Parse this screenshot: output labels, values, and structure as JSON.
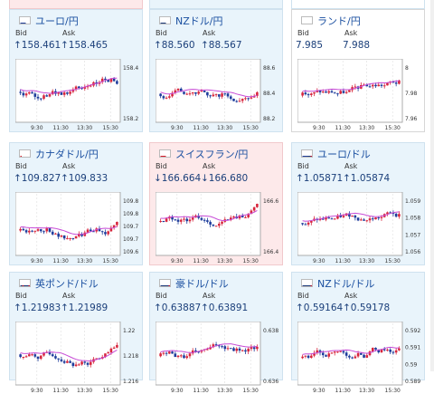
{
  "labels": {
    "bid": "Bid",
    "ask": "Ask"
  },
  "times": [
    "9:30",
    "11:30",
    "13:30",
    "15:30"
  ],
  "cards": [
    {
      "pair": "ユーロ/円",
      "flag": "eu-jp",
      "bid": "↑158.461",
      "ask": "↑158.465",
      "dir": "up",
      "theme": "blue",
      "ticks": [
        "158.4",
        "158.2"
      ],
      "seed": 1
    },
    {
      "pair": "NZドル/円",
      "flag": "nz-jp",
      "bid": "↑88.560",
      "ask": "↑88.567",
      "dir": "up",
      "theme": "blue",
      "ticks": [
        "88.6",
        "88.4",
        "88.2"
      ],
      "seed": 2
    },
    {
      "pair": "ランド/円",
      "flag": "za-jp",
      "bid": "7.985",
      "ask": "7.988",
      "dir": "flat",
      "theme": "white",
      "ticks": [
        "8",
        "7.98",
        "7.96"
      ],
      "seed": 3
    },
    {
      "pair": "カナダドル/円",
      "flag": "ca-jp",
      "bid": "↑109.827",
      "ask": "↑109.833",
      "dir": "up",
      "theme": "blue",
      "ticks": [
        "109.85",
        "109.8",
        "109.75",
        "109.7",
        "109.65"
      ],
      "seed": 4
    },
    {
      "pair": "スイスフラン/円",
      "flag": "ch-jp",
      "bid": "↓166.664",
      "ask": "↓166.680",
      "dir": "down",
      "theme": "red",
      "ticks": [
        "166.6",
        "166.4"
      ],
      "seed": 5
    },
    {
      "pair": "ユーロ/ドル",
      "flag": "eu-us",
      "bid": "↑1.05871",
      "ask": "↑1.05874",
      "dir": "up",
      "theme": "blue",
      "ticks": [
        "1.059",
        "1.058",
        "1.057",
        "1.056"
      ],
      "seed": 6
    },
    {
      "pair": "英ポンド/ドル",
      "flag": "gb-us",
      "bid": "↑1.21983",
      "ask": "↑1.21989",
      "dir": "up",
      "theme": "blue",
      "ticks": [
        "1.22",
        "1.218",
        "1.216"
      ],
      "seed": 7
    },
    {
      "pair": "豪ドル/ドル",
      "flag": "au-us",
      "bid": "↑0.63887",
      "ask": "↑0.63891",
      "dir": "up",
      "theme": "blue",
      "ticks": [
        "0.638",
        "0.636"
      ],
      "seed": 8
    },
    {
      "pair": "NZドル/ドル",
      "flag": "nz-us",
      "bid": "↑0.59164",
      "ask": "↑0.59178",
      "dir": "up",
      "theme": "blue",
      "ticks": [
        "0.592",
        "0.591",
        "0.59",
        "0.589"
      ],
      "seed": 9
    }
  ]
}
